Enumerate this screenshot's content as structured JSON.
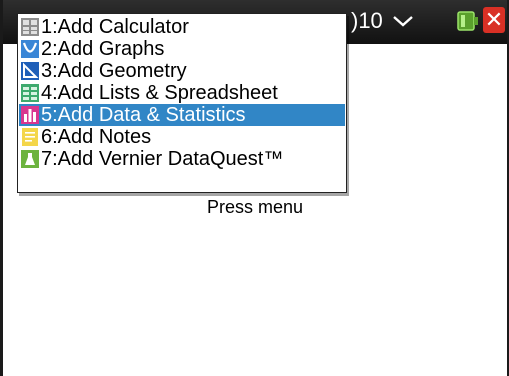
{
  "status_bar": {
    "doc_name_fragment": ")10"
  },
  "prompt_text": "Press menu",
  "menu": {
    "items": [
      {
        "label": "1:Add Calculator",
        "icon": "calculator-icon",
        "selected": false
      },
      {
        "label": "2:Add Graphs",
        "icon": "graphs-icon",
        "selected": false
      },
      {
        "label": "3:Add Geometry",
        "icon": "geometry-icon",
        "selected": false
      },
      {
        "label": "4:Add Lists & Spreadsheet",
        "icon": "spreadsheet-icon",
        "selected": false
      },
      {
        "label": "5:Add Data & Statistics",
        "icon": "data-statistics-icon",
        "selected": true
      },
      {
        "label": "6:Add Notes",
        "icon": "notes-icon",
        "selected": false
      },
      {
        "label": "7:Add Vernier DataQuest™",
        "icon": "dataquest-icon",
        "selected": false
      }
    ]
  },
  "colors": {
    "selection": "#3186c6",
    "close_button": "#d93025",
    "status_bar": "#1a1a1a"
  }
}
